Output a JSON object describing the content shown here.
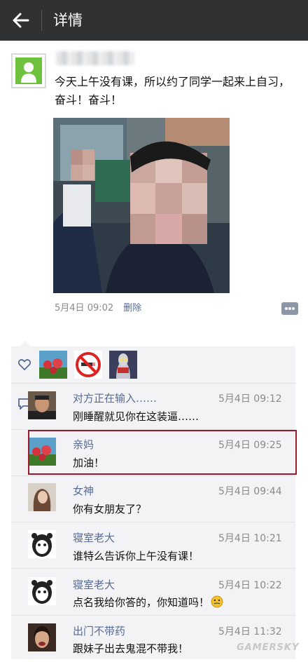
{
  "header": {
    "title": "详情"
  },
  "post": {
    "text": "今天上午没有课，所以约了同学一起来上自习，奋斗！奋斗！",
    "date": "5月4日",
    "time": "09:02",
    "delete_label": "删除"
  },
  "likes": {
    "icons": [
      "heart-icon"
    ]
  },
  "comments": [
    {
      "name": "对方正在输入……",
      "date": "5月4日",
      "time": "09:12",
      "text": "刚睡醒就见你在这装逼……"
    },
    {
      "name": "亲妈",
      "date": "5月4日",
      "time": "09:25",
      "text": "加油！"
    },
    {
      "name": "女神",
      "date": "5月4日",
      "time": "09:44",
      "text": "你有女朋友了？"
    },
    {
      "name": "寝室老大",
      "date": "5月4日",
      "time": "10:21",
      "text": "谁特么告诉你上午没有课！"
    },
    {
      "name": "寝室老大",
      "date": "5月4日",
      "time": "10:22",
      "text": "点名我给你答的，你知道吗！"
    },
    {
      "name": "出门不带药",
      "date": "5月4日",
      "time": "11:32",
      "text": "跟妹子出去鬼混不带我！"
    }
  ],
  "watermark": "GAMERSKY",
  "colors": {
    "topbar": "#2f3133",
    "link": "#576b95",
    "highlight": "#9a1b2a",
    "panel": "#f3f3f5"
  }
}
